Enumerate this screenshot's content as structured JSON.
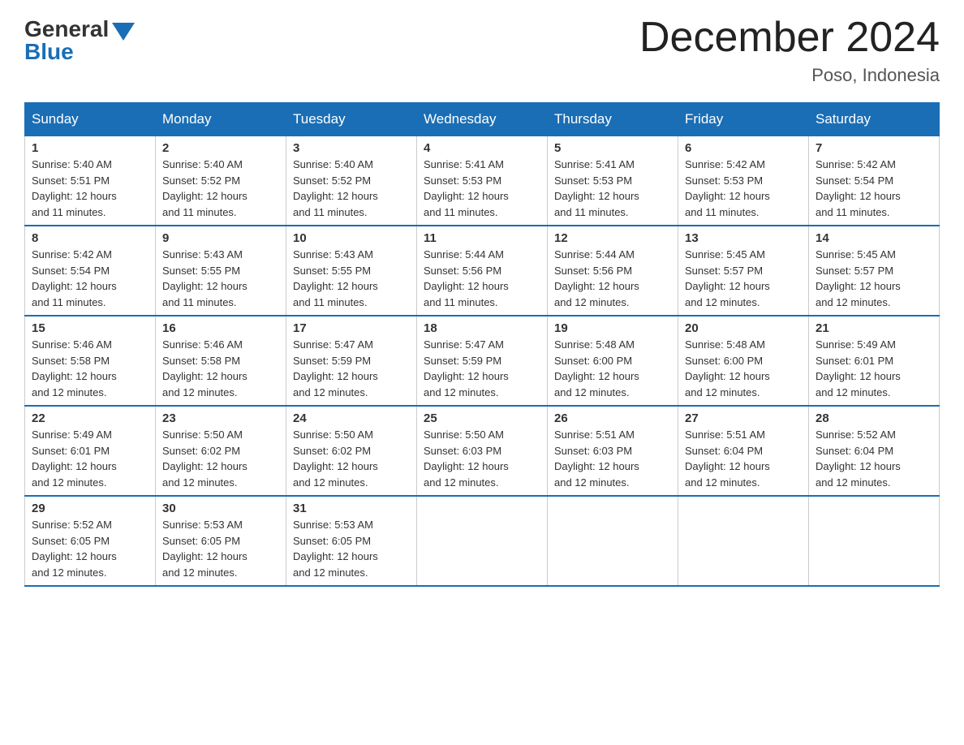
{
  "header": {
    "logo_general": "General",
    "logo_blue": "Blue",
    "title": "December 2024",
    "location": "Poso, Indonesia"
  },
  "days_of_week": [
    "Sunday",
    "Monday",
    "Tuesday",
    "Wednesday",
    "Thursday",
    "Friday",
    "Saturday"
  ],
  "weeks": [
    [
      {
        "day": "1",
        "sunrise": "5:40 AM",
        "sunset": "5:51 PM",
        "daylight": "12 hours and 11 minutes."
      },
      {
        "day": "2",
        "sunrise": "5:40 AM",
        "sunset": "5:52 PM",
        "daylight": "12 hours and 11 minutes."
      },
      {
        "day": "3",
        "sunrise": "5:40 AM",
        "sunset": "5:52 PM",
        "daylight": "12 hours and 11 minutes."
      },
      {
        "day": "4",
        "sunrise": "5:41 AM",
        "sunset": "5:53 PM",
        "daylight": "12 hours and 11 minutes."
      },
      {
        "day": "5",
        "sunrise": "5:41 AM",
        "sunset": "5:53 PM",
        "daylight": "12 hours and 11 minutes."
      },
      {
        "day": "6",
        "sunrise": "5:42 AM",
        "sunset": "5:53 PM",
        "daylight": "12 hours and 11 minutes."
      },
      {
        "day": "7",
        "sunrise": "5:42 AM",
        "sunset": "5:54 PM",
        "daylight": "12 hours and 11 minutes."
      }
    ],
    [
      {
        "day": "8",
        "sunrise": "5:42 AM",
        "sunset": "5:54 PM",
        "daylight": "12 hours and 11 minutes."
      },
      {
        "day": "9",
        "sunrise": "5:43 AM",
        "sunset": "5:55 PM",
        "daylight": "12 hours and 11 minutes."
      },
      {
        "day": "10",
        "sunrise": "5:43 AM",
        "sunset": "5:55 PM",
        "daylight": "12 hours and 11 minutes."
      },
      {
        "day": "11",
        "sunrise": "5:44 AM",
        "sunset": "5:56 PM",
        "daylight": "12 hours and 11 minutes."
      },
      {
        "day": "12",
        "sunrise": "5:44 AM",
        "sunset": "5:56 PM",
        "daylight": "12 hours and 12 minutes."
      },
      {
        "day": "13",
        "sunrise": "5:45 AM",
        "sunset": "5:57 PM",
        "daylight": "12 hours and 12 minutes."
      },
      {
        "day": "14",
        "sunrise": "5:45 AM",
        "sunset": "5:57 PM",
        "daylight": "12 hours and 12 minutes."
      }
    ],
    [
      {
        "day": "15",
        "sunrise": "5:46 AM",
        "sunset": "5:58 PM",
        "daylight": "12 hours and 12 minutes."
      },
      {
        "day": "16",
        "sunrise": "5:46 AM",
        "sunset": "5:58 PM",
        "daylight": "12 hours and 12 minutes."
      },
      {
        "day": "17",
        "sunrise": "5:47 AM",
        "sunset": "5:59 PM",
        "daylight": "12 hours and 12 minutes."
      },
      {
        "day": "18",
        "sunrise": "5:47 AM",
        "sunset": "5:59 PM",
        "daylight": "12 hours and 12 minutes."
      },
      {
        "day": "19",
        "sunrise": "5:48 AM",
        "sunset": "6:00 PM",
        "daylight": "12 hours and 12 minutes."
      },
      {
        "day": "20",
        "sunrise": "5:48 AM",
        "sunset": "6:00 PM",
        "daylight": "12 hours and 12 minutes."
      },
      {
        "day": "21",
        "sunrise": "5:49 AM",
        "sunset": "6:01 PM",
        "daylight": "12 hours and 12 minutes."
      }
    ],
    [
      {
        "day": "22",
        "sunrise": "5:49 AM",
        "sunset": "6:01 PM",
        "daylight": "12 hours and 12 minutes."
      },
      {
        "day": "23",
        "sunrise": "5:50 AM",
        "sunset": "6:02 PM",
        "daylight": "12 hours and 12 minutes."
      },
      {
        "day": "24",
        "sunrise": "5:50 AM",
        "sunset": "6:02 PM",
        "daylight": "12 hours and 12 minutes."
      },
      {
        "day": "25",
        "sunrise": "5:50 AM",
        "sunset": "6:03 PM",
        "daylight": "12 hours and 12 minutes."
      },
      {
        "day": "26",
        "sunrise": "5:51 AM",
        "sunset": "6:03 PM",
        "daylight": "12 hours and 12 minutes."
      },
      {
        "day": "27",
        "sunrise": "5:51 AM",
        "sunset": "6:04 PM",
        "daylight": "12 hours and 12 minutes."
      },
      {
        "day": "28",
        "sunrise": "5:52 AM",
        "sunset": "6:04 PM",
        "daylight": "12 hours and 12 minutes."
      }
    ],
    [
      {
        "day": "29",
        "sunrise": "5:52 AM",
        "sunset": "6:05 PM",
        "daylight": "12 hours and 12 minutes."
      },
      {
        "day": "30",
        "sunrise": "5:53 AM",
        "sunset": "6:05 PM",
        "daylight": "12 hours and 12 minutes."
      },
      {
        "day": "31",
        "sunrise": "5:53 AM",
        "sunset": "6:05 PM",
        "daylight": "12 hours and 12 minutes."
      },
      null,
      null,
      null,
      null
    ]
  ],
  "labels": {
    "sunrise": "Sunrise:",
    "sunset": "Sunset:",
    "daylight": "Daylight:"
  }
}
